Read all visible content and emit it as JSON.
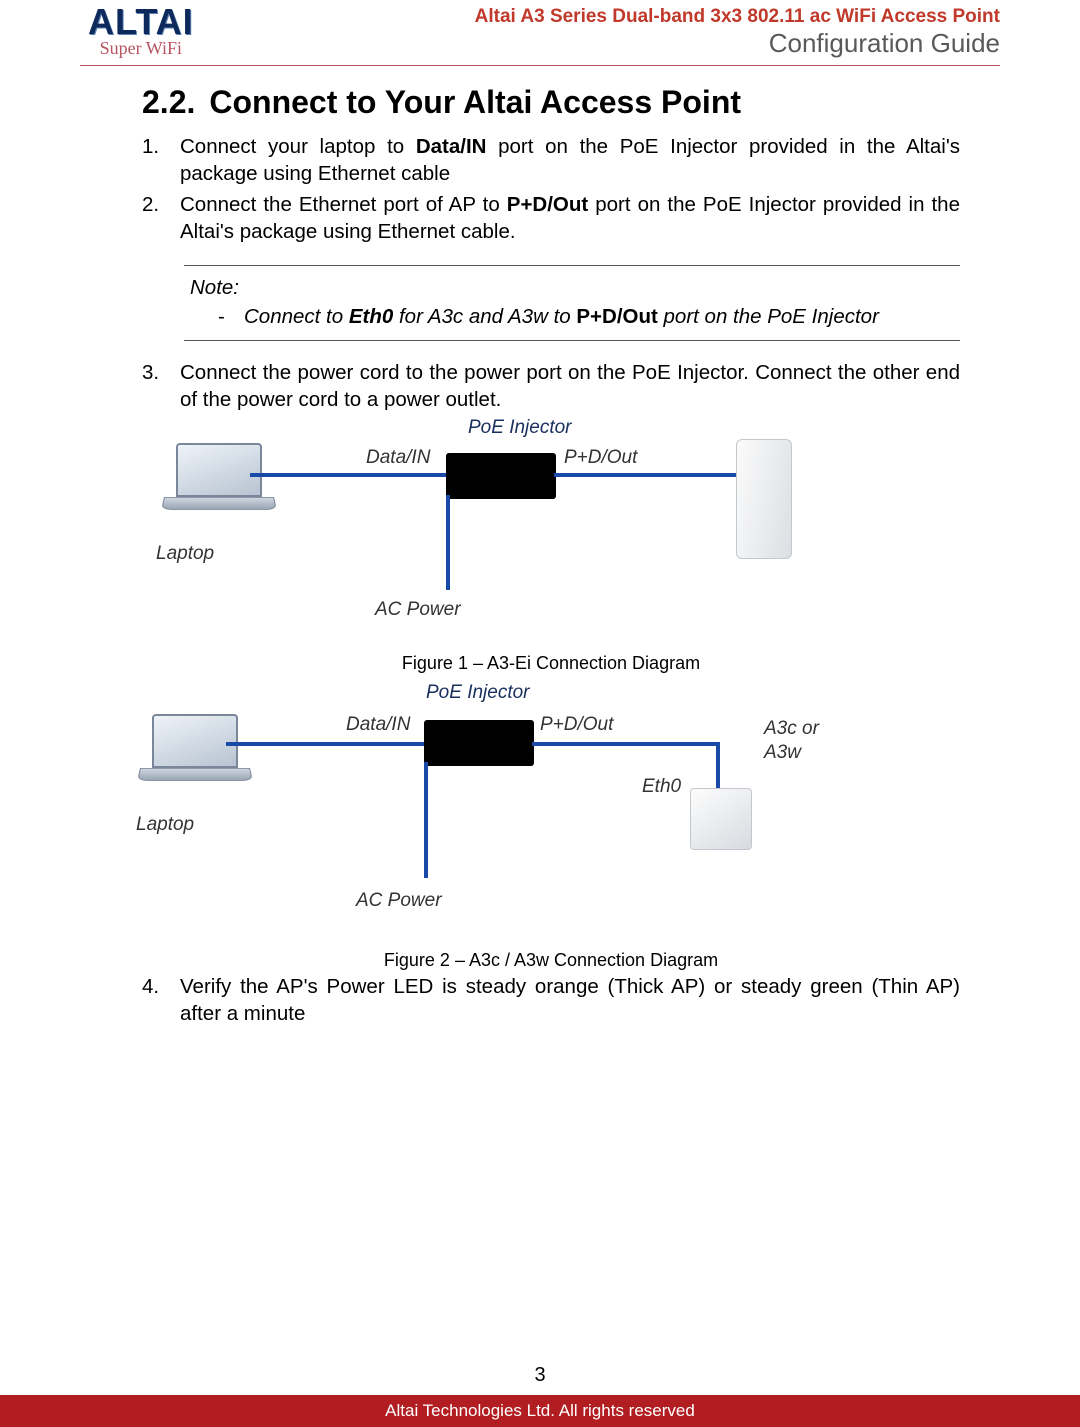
{
  "header": {
    "logo_main": "ALTAI",
    "logo_sub": "Super WiFi",
    "product": "Altai A3 Series Dual-band 3x3 802.11 ac WiFi Access Point",
    "guide": "Configuration Guide"
  },
  "section": {
    "number": "2.2.",
    "title": "Connect to Your Altai Access Point"
  },
  "steps": {
    "s1": {
      "num": "1.",
      "pre": "Connect your laptop to ",
      "bold": "Data/IN",
      "post": " port on the PoE Injector provided in the Altai's package using Ethernet cable"
    },
    "s2": {
      "num": "2.",
      "pre": "Connect the Ethernet port of AP to ",
      "bold": "P+D/Out",
      "post": " port on the PoE Injector provided in the Altai's package using Ethernet cable."
    },
    "s3": {
      "num": "3.",
      "text": "Connect the power cord to the power port on the PoE Injector. Connect the other end of the power cord to a power outlet."
    },
    "s4": {
      "num": "4.",
      "text": "Verify the AP's Power LED is steady orange (Thick AP) or steady green (Thin AP) after a minute"
    }
  },
  "note": {
    "title": "Note:",
    "dash": "-",
    "pre": "Connect to ",
    "eth0": "Eth0",
    "mid": " for A3c and A3w to ",
    "pdout": "P+D/Out",
    "post": " port on the PoE Injector"
  },
  "diagram_labels": {
    "poe_injector": "PoE Injector",
    "data_in": "Data/IN",
    "pd_out": "P+D/Out",
    "laptop": "Laptop",
    "ac_power": "AC Power",
    "eth0": "Eth0",
    "a3c_or": "A3c or",
    "a3w": "A3w"
  },
  "captions": {
    "fig1": "Figure 1 – A3-Ei Connection Diagram",
    "fig2": "Figure 2 – A3c / A3w Connection Diagram"
  },
  "page_number": "3",
  "footer": "Altai Technologies Ltd. All rights reserved"
}
